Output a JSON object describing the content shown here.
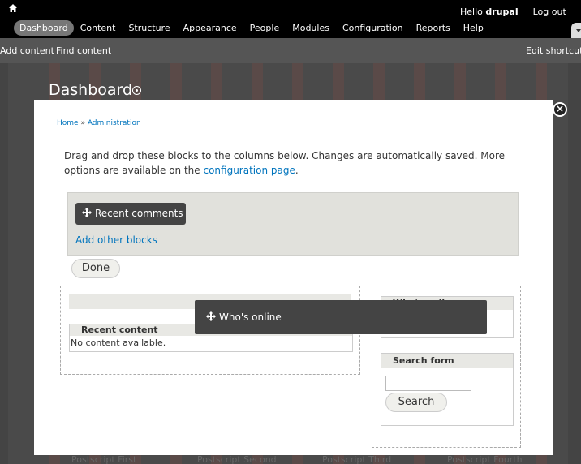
{
  "toolbar": {
    "home_icon": "home-icon",
    "nav": [
      "Dashboard",
      "Content",
      "Structure",
      "Appearance",
      "People",
      "Modules",
      "Configuration",
      "Reports",
      "Help"
    ],
    "active_nav": "Dashboard",
    "hello_prefix": "Hello ",
    "username": "drupal",
    "logout": "Log out"
  },
  "shortcuts": {
    "add_content": "Add content",
    "find_content": "Find content",
    "edit_shortcuts": "Edit shortcuts"
  },
  "page": {
    "title": "Dashboard",
    "postscripts": [
      "Postscript First",
      "Postscript Second",
      "Postscript Third",
      "Postscript Fourth"
    ]
  },
  "overlay": {
    "close_icon": "close-icon",
    "breadcrumb_home": "Home",
    "breadcrumb_sep": " » ",
    "breadcrumb_admin": "Administration",
    "help_text": "Drag and drop these blocks to the columns below. Changes are automatically saved. More options are available on the ",
    "help_link": "configuration page",
    "help_end": ".",
    "disabled_block": "Recent comments",
    "add_other": "Add other blocks",
    "done": "Done",
    "recent_content_title": "Recent content",
    "recent_content_body": "No content available.",
    "whos_online_title": "Who's online",
    "search_form_title": "Search form",
    "search_button": "Search",
    "dragging_block": "Who's online"
  },
  "colors": {
    "toolbar_bg": "#000000",
    "link": "#0074bd",
    "block_bg": "#444444"
  }
}
